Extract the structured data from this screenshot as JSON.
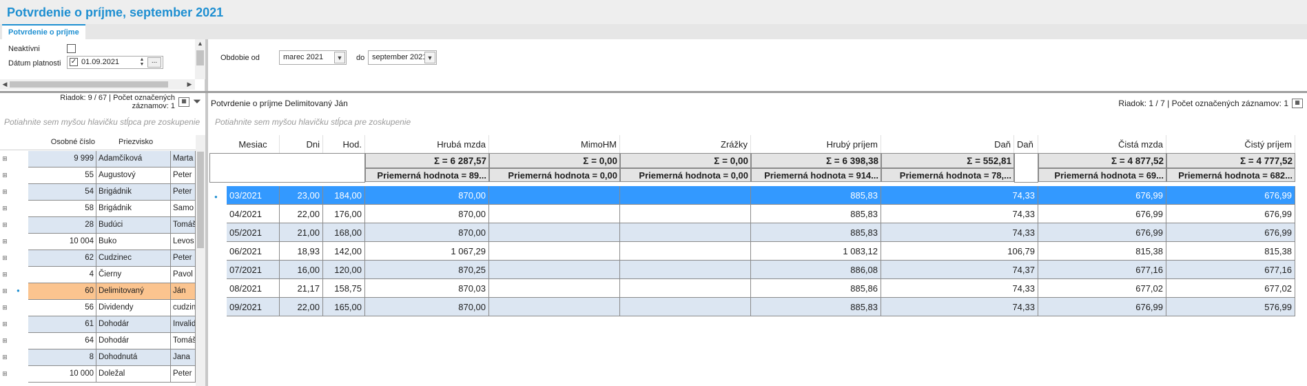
{
  "window": {
    "title": "Potvrdenie o príjme, september 2021"
  },
  "tabs": [
    {
      "label": "Potvrdenie o príjme"
    }
  ],
  "filter_left": {
    "inactive_label": "Neaktívni",
    "inactive_checked": false,
    "date_label": "Dátum platnosti",
    "date_checked": true,
    "date_value": "01.09.2021",
    "date_button": "..."
  },
  "filter_right": {
    "period_from_label": "Obdobie od",
    "period_from_value": "marec 2021",
    "period_to_label": "do",
    "period_to_value": "september 2021"
  },
  "left_grid": {
    "status": "Riadok: 9 / 67 | Počet označených záznamov: 1",
    "group_hint": "Potiahnite sem myšou hlavičku stĺpca pre zoskupenie",
    "columns": [
      "Osobné číslo",
      "Priezvisko",
      ""
    ],
    "rows": [
      {
        "num": "9 999",
        "surname": "Adamčíková",
        "name": "Marta"
      },
      {
        "num": "55",
        "surname": "Augustový",
        "name": "Peter"
      },
      {
        "num": "54",
        "surname": "Brigádnik",
        "name": "Peter"
      },
      {
        "num": "58",
        "surname": "Brigádnik",
        "name": "Samo"
      },
      {
        "num": "28",
        "surname": "Budúci",
        "name": "Tomáš"
      },
      {
        "num": "10 004",
        "surname": "Buko",
        "name": "Levos"
      },
      {
        "num": "62",
        "surname": "Cudzinec",
        "name": "Peter"
      },
      {
        "num": "4",
        "surname": "Čierny",
        "name": "Pavol"
      },
      {
        "num": "60",
        "surname": "Delimitovaný",
        "name": "Ján"
      },
      {
        "num": "56",
        "surname": "Dividendy",
        "name": "cudzin"
      },
      {
        "num": "61",
        "surname": "Dohodár",
        "name": "Invalid"
      },
      {
        "num": "64",
        "surname": "Dohodár",
        "name": "Tomáš"
      },
      {
        "num": "8",
        "surname": "Dohodnutá",
        "name": "Jana"
      },
      {
        "num": "10 000",
        "surname": "Doležal",
        "name": "Peter"
      }
    ],
    "selected_index": 8
  },
  "right_grid": {
    "caption": "Potvrdenie o príjme Delimitovaný Ján",
    "status": "Riadok: 1 / 7 | Počet označených záznamov: 1",
    "group_hint": "Potiahnite sem myšou hlavičku stĺpca pre zoskupenie",
    "columns": [
      "Mesiac",
      "Dni",
      "Hod.",
      "Hrubá mzda",
      "MimoHM",
      "Zrážky",
      "Hrubý príjem",
      "Daň",
      "Daň",
      "Čistá mzda",
      "Čistý príjem"
    ],
    "sums": [
      "",
      "",
      "",
      "Σ = 6 287,57",
      "Σ = 0,00",
      "Σ = 0,00",
      "Σ = 6 398,38",
      "Σ = 552,81",
      "",
      "Σ = 4 877,52",
      "Σ = 4 777,52"
    ],
    "averages": [
      "",
      "",
      "",
      "Priemerná hodnota = 89...",
      "Priemerná hodnota = 0,00",
      "Priemerná hodnota = 0,00",
      "Priemerná hodnota = 914...",
      "Priemerná hodnota = 78,...",
      "",
      "Priemerná hodnota = 69...",
      "Priemerná hodnota = 682..."
    ],
    "rows": [
      [
        "03/2021",
        "23,00",
        "184,00",
        "870,00",
        "",
        "",
        "885,83",
        "74,33",
        "676,99",
        "676,99"
      ],
      [
        "04/2021",
        "22,00",
        "176,00",
        "870,00",
        "",
        "",
        "885,83",
        "74,33",
        "676,99",
        "676,99"
      ],
      [
        "05/2021",
        "21,00",
        "168,00",
        "870,00",
        "",
        "",
        "885,83",
        "74,33",
        "676,99",
        "676,99"
      ],
      [
        "06/2021",
        "18,93",
        "142,00",
        "1 067,29",
        "",
        "",
        "1 083,12",
        "106,79",
        "815,38",
        "815,38"
      ],
      [
        "07/2021",
        "16,00",
        "120,00",
        "870,25",
        "",
        "",
        "886,08",
        "74,37",
        "677,16",
        "677,16"
      ],
      [
        "08/2021",
        "21,17",
        "158,75",
        "870,03",
        "",
        "",
        "885,86",
        "74,33",
        "677,02",
        "677,02"
      ],
      [
        "09/2021",
        "22,00",
        "165,00",
        "870,00",
        "",
        "",
        "885,83",
        "74,33",
        "676,99",
        "576,99"
      ]
    ],
    "selected_index": 0
  },
  "colors": {
    "accent": "#1e8fd1",
    "row_alt": "#dce6f2",
    "row_selected": "#3399ff",
    "left_selected": "#fbc48f"
  }
}
